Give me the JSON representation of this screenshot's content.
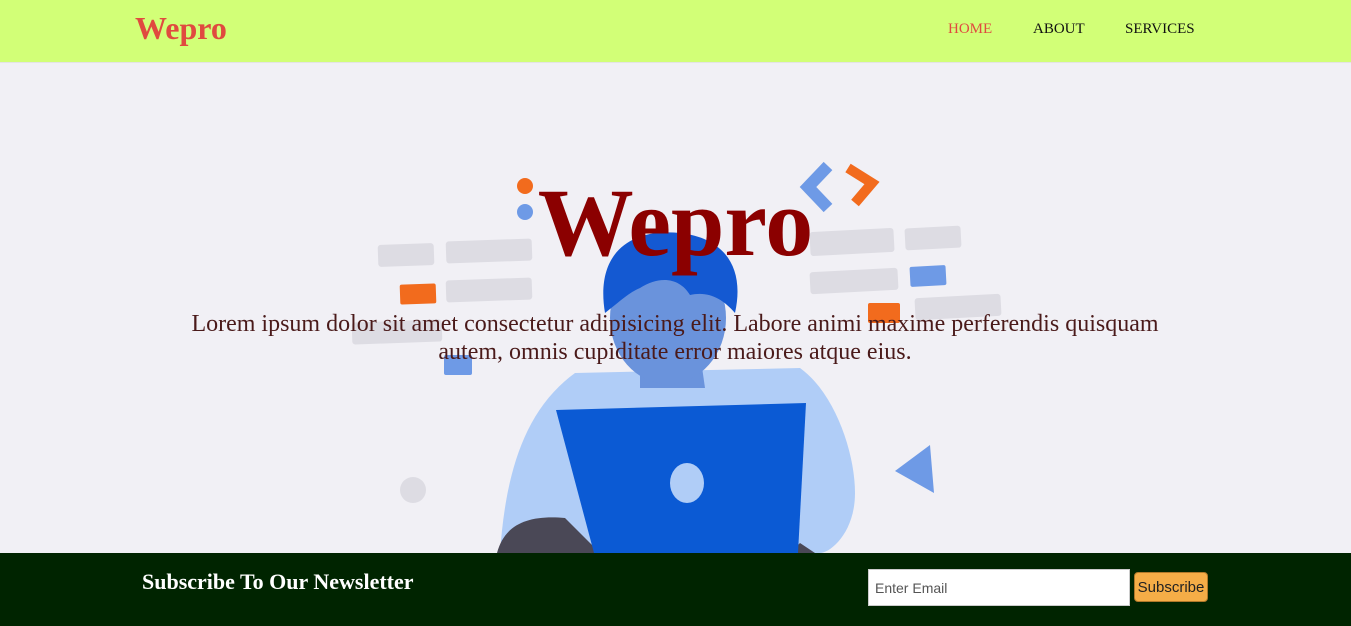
{
  "navbar": {
    "brand": "Wepro",
    "links": [
      {
        "label": "HOME",
        "active": true
      },
      {
        "label": "ABOUT",
        "active": false
      },
      {
        "label": "SERVICES",
        "active": false
      }
    ]
  },
  "hero": {
    "title": "Wepro",
    "text": "Lorem ipsum dolor sit amet consectetur adipisicing elit. Labore animi maxime perferendis quisquam autem, omnis cupiditate error maiores atque eius.",
    "illustration": "person-with-laptop-illustration"
  },
  "newsletter": {
    "title": "Subscribe To Our Newsletter",
    "email_placeholder": "Enter Email",
    "email_value": "",
    "button_label": "Subscribe"
  },
  "colors": {
    "navbar_bg": "#d2ff77",
    "brand": "#e04a3f",
    "hero_title": "#8b0000",
    "footer_bg": "#002400",
    "button_bg": "#f5ad47"
  }
}
